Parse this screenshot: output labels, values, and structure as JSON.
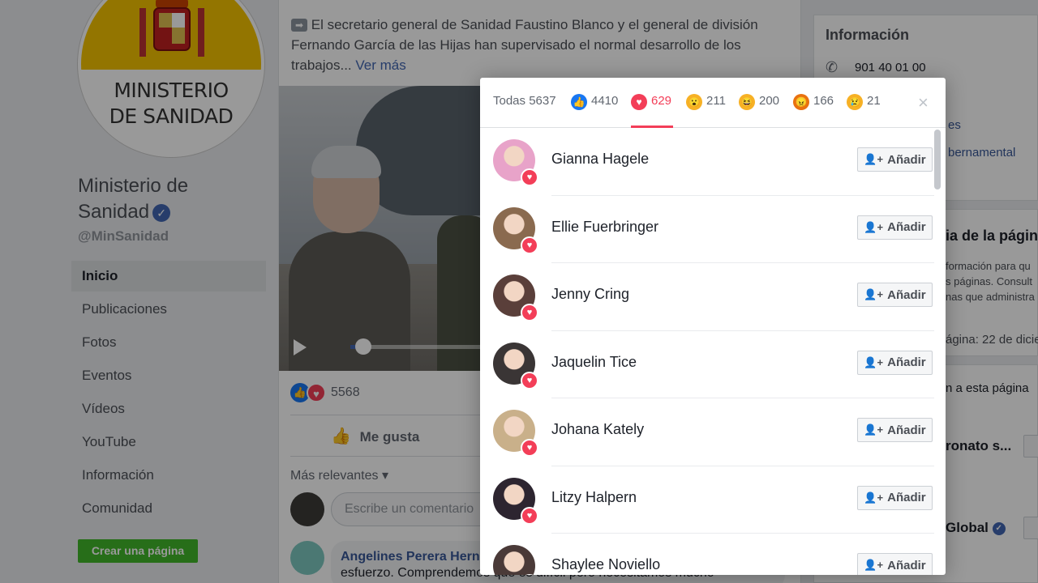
{
  "sidebar": {
    "avatar_text_line1": "MINISTERIO",
    "avatar_text_line2": "DE SANIDAD",
    "page_name": "Ministerio de Sanidad",
    "handle": "@MinSanidad",
    "nav": [
      "Inicio",
      "Publicaciones",
      "Fotos",
      "Eventos",
      "Vídeos",
      "YouTube",
      "Información",
      "Comunidad"
    ],
    "create_page": "Crear una página"
  },
  "post": {
    "text": "El secretario general de Sanidad Faustino Blanco y el general de división Fernando García de las Hijas han supervisado el normal desarrollo de los trabajos...",
    "see_more": "Ver más",
    "reactions_count": "5568",
    "video_progress": 0.06,
    "like_button": "Me gusta",
    "sort_comments": "Más relevantes ▾",
    "comment_placeholder": "Escribe un comentario",
    "comment_author": "Angelines Perera Hern",
    "comment_text": "esfuerzo. Comprendemos que es difícil pero necesitamos mucho"
  },
  "right": {
    "info_title": "Información",
    "phone": "901 40 01 00",
    "link1": "es",
    "link2": "bernamental",
    "transparency_title": "ia de la página",
    "transparency_desc": [
      "formación para qu",
      "s páginas. Consult",
      "nas que administra"
    ],
    "transparency_date": "ágina: 22 de dicie",
    "liked_title": "n a esta página",
    "liked1": "ronato s...",
    "liked2": "Global"
  },
  "modal": {
    "tabs": [
      {
        "icon": "all",
        "label": "Todas",
        "count": "5637"
      },
      {
        "icon": "like-icon",
        "label": "",
        "count": "4410",
        "color": "#1877f2"
      },
      {
        "icon": "love-icon",
        "label": "",
        "count": "629",
        "color": "#f33e58"
      },
      {
        "icon": "wow-icon",
        "label": "",
        "count": "211",
        "color": "#f7b125"
      },
      {
        "icon": "haha-icon",
        "label": "",
        "count": "200",
        "color": "#f7b125"
      },
      {
        "icon": "angry-icon",
        "label": "",
        "count": "166",
        "color": "#e9710f"
      },
      {
        "icon": "sad-icon",
        "label": "",
        "count": "21",
        "color": "#f7b125"
      }
    ],
    "active_tab": "love",
    "add_label": "Añadir",
    "people": [
      {
        "name": "Gianna Hagele",
        "color": "#e8a3c9"
      },
      {
        "name": "Ellie Fuerbringer",
        "color": "#8a6a4f"
      },
      {
        "name": "Jenny Cring",
        "color": "#5a3f3a"
      },
      {
        "name": "Jaquelin Tice",
        "color": "#3a3535"
      },
      {
        "name": "Johana Kately",
        "color": "#c9b08a"
      },
      {
        "name": "Litzy Halpern",
        "color": "#2d2530"
      },
      {
        "name": "Shaylee Noviello",
        "color": "#4a3a38"
      }
    ]
  },
  "colors": {
    "facebook_blue": "#4267b2",
    "love_red": "#f33e58",
    "create_green": "#42b72a"
  }
}
